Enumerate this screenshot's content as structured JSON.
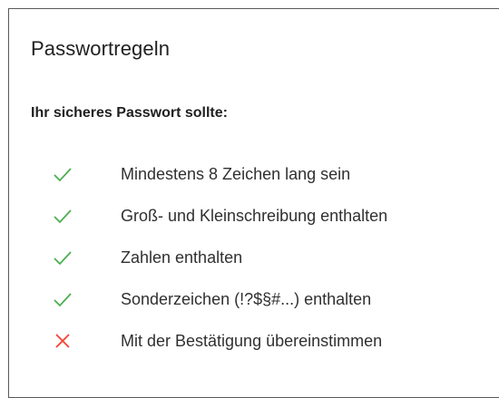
{
  "panel": {
    "title": "Passwortregeln",
    "intro": "Ihr sicheres Passwort sollte:"
  },
  "rules": [
    {
      "label": "Mindestens 8 Zeichen lang sein",
      "status": "met",
      "icon": "check-icon"
    },
    {
      "label": "Groß- und Kleinschreibung enthalten",
      "status": "met",
      "icon": "check-icon"
    },
    {
      "label": "Zahlen enthalten",
      "status": "met",
      "icon": "check-icon"
    },
    {
      "label": "Sonderzeichen (!?$§#...) enthalten",
      "status": "met",
      "icon": "check-icon"
    },
    {
      "label": "Mit der Bestätigung übereinstimmen",
      "status": "unmet",
      "icon": "cross-icon"
    }
  ],
  "colors": {
    "met": "#4caf50",
    "unmet": "#f44336"
  }
}
